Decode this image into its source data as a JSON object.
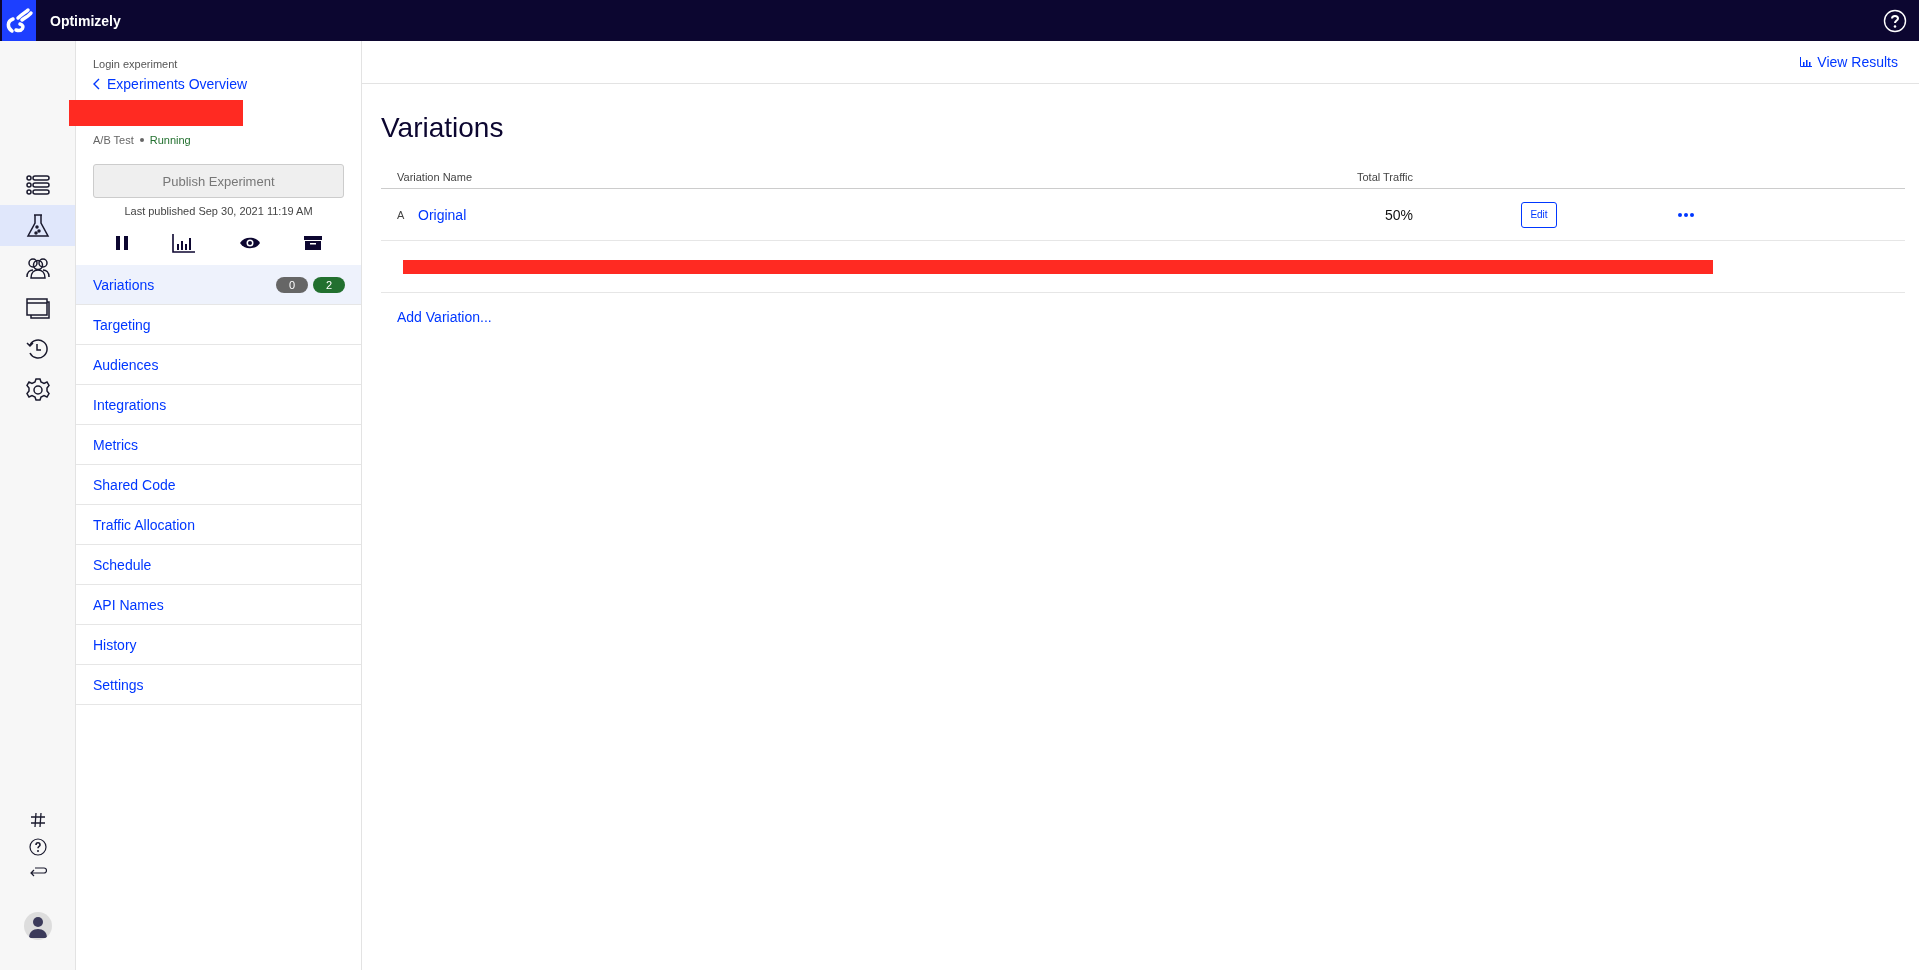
{
  "header": {
    "brand": "Optimizely"
  },
  "rail": {
    "items": [
      {
        "kind": "list",
        "selected": false
      },
      {
        "kind": "flask",
        "selected": true
      },
      {
        "kind": "people",
        "selected": false
      },
      {
        "kind": "windows",
        "selected": false
      },
      {
        "kind": "history",
        "selected": false
      },
      {
        "kind": "gear",
        "selected": false
      }
    ],
    "bottom": [
      {
        "kind": "hash"
      },
      {
        "kind": "help"
      },
      {
        "kind": "return"
      },
      {
        "kind": "avatar"
      }
    ]
  },
  "sidebar": {
    "breadcrumb": "Login experiment",
    "back_link": "Experiments Overview",
    "type": "A/B Test",
    "status": "Running",
    "publish_button": "Publish Experiment",
    "last_published": "Last published Sep 30, 2021 11:19 AM",
    "actions": [
      {
        "kind": "pause"
      },
      {
        "kind": "chart"
      },
      {
        "kind": "eye"
      },
      {
        "kind": "archive"
      }
    ],
    "nav": [
      {
        "label": "Variations",
        "selected": true,
        "badges": [
          {
            "text": "0",
            "color": "#666666"
          },
          {
            "text": "2",
            "color": "#22702f"
          }
        ]
      },
      {
        "label": "Targeting",
        "selected": false
      },
      {
        "label": "Audiences",
        "selected": false
      },
      {
        "label": "Integrations",
        "selected": false
      },
      {
        "label": "Metrics",
        "selected": false
      },
      {
        "label": "Shared Code",
        "selected": false
      },
      {
        "label": "Traffic Allocation",
        "selected": false
      },
      {
        "label": "Schedule",
        "selected": false
      },
      {
        "label": "API Names",
        "selected": false
      },
      {
        "label": "History",
        "selected": false
      },
      {
        "label": "Settings",
        "selected": false
      }
    ]
  },
  "main": {
    "view_results": "View Results",
    "title": "Variations",
    "table": {
      "columns": [
        "Variation Name",
        "Total Traffic"
      ],
      "rows": [
        {
          "kind": "variation",
          "letter": "A",
          "name": "Original",
          "traffic": "50%",
          "action": "Edit"
        },
        {
          "kind": "redacted"
        }
      ]
    },
    "add_variation": "Add Variation..."
  }
}
